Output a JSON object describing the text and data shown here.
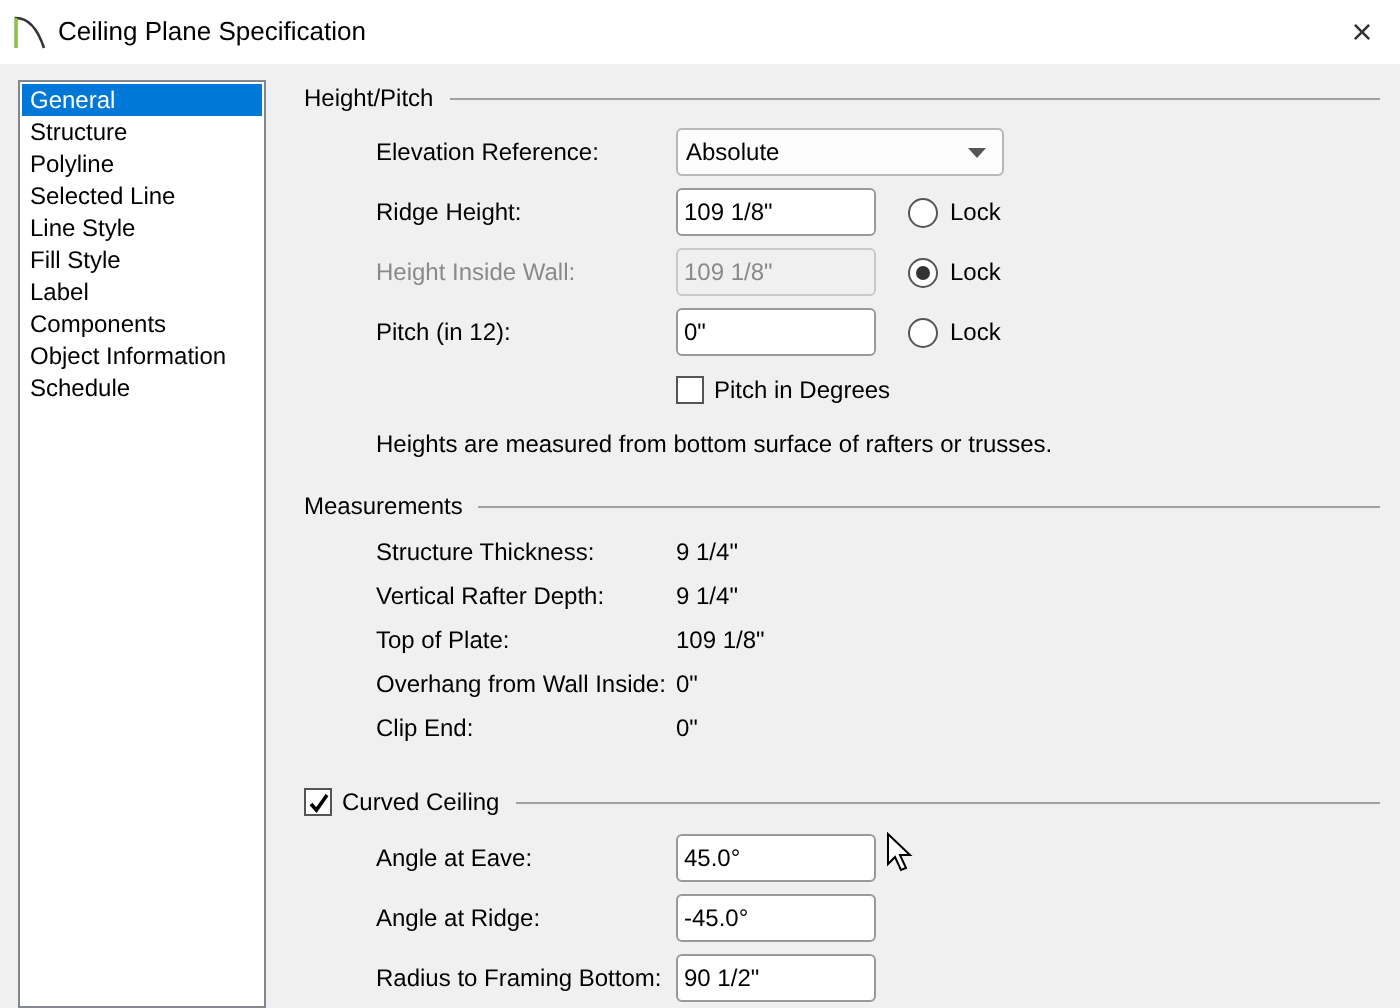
{
  "window": {
    "title": "Ceiling Plane Specification",
    "close": "×"
  },
  "sidebar": {
    "items": [
      {
        "label": "General",
        "selected": true
      },
      {
        "label": "Structure",
        "selected": false
      },
      {
        "label": "Polyline",
        "selected": false
      },
      {
        "label": "Selected Line",
        "selected": false
      },
      {
        "label": "Line Style",
        "selected": false
      },
      {
        "label": "Fill Style",
        "selected": false
      },
      {
        "label": "Label",
        "selected": false
      },
      {
        "label": "Components",
        "selected": false
      },
      {
        "label": "Object Information",
        "selected": false
      },
      {
        "label": "Schedule",
        "selected": false
      }
    ]
  },
  "height_pitch": {
    "title": "Height/Pitch",
    "rows": [
      {
        "kind": "dropdown",
        "label": "Elevation Reference:",
        "value": "Absolute",
        "disabled": false
      },
      {
        "kind": "field",
        "label": "Ridge Height:",
        "value": "109 1/8\"",
        "disabled": false,
        "lock": {
          "label": "Lock",
          "selected": false
        }
      },
      {
        "kind": "field",
        "label": "Height Inside Wall:",
        "value": "109 1/8\"",
        "disabled": true,
        "lock": {
          "label": "Lock",
          "selected": true
        }
      },
      {
        "kind": "field",
        "label": "Pitch (in 12):",
        "value": "0\"",
        "disabled": false,
        "lock": {
          "label": "Lock",
          "selected": false
        }
      },
      {
        "kind": "checkbox",
        "label": "Pitch in Degrees",
        "checked": false
      }
    ],
    "note": "Heights are measured from bottom surface of rafters or trusses."
  },
  "measurements": {
    "title": "Measurements",
    "rows": [
      {
        "label": "Structure Thickness:",
        "value": "9 1/4\""
      },
      {
        "label": "Vertical Rafter Depth:",
        "value": "9 1/4\""
      },
      {
        "label": "Top of Plate:",
        "value": "109 1/8\""
      },
      {
        "label": "Overhang from Wall Inside:",
        "value": "0\""
      },
      {
        "label": "Clip End:",
        "value": "0\""
      }
    ]
  },
  "curved_ceiling": {
    "title": "Curved Ceiling",
    "checked": true,
    "rows": [
      {
        "label": "Angle at Eave:",
        "value": "45.0°"
      },
      {
        "label": "Angle at Ridge:",
        "value": "-45.0°"
      },
      {
        "label": "Radius to Framing Bottom:",
        "value": "90 1/2\""
      }
    ]
  }
}
